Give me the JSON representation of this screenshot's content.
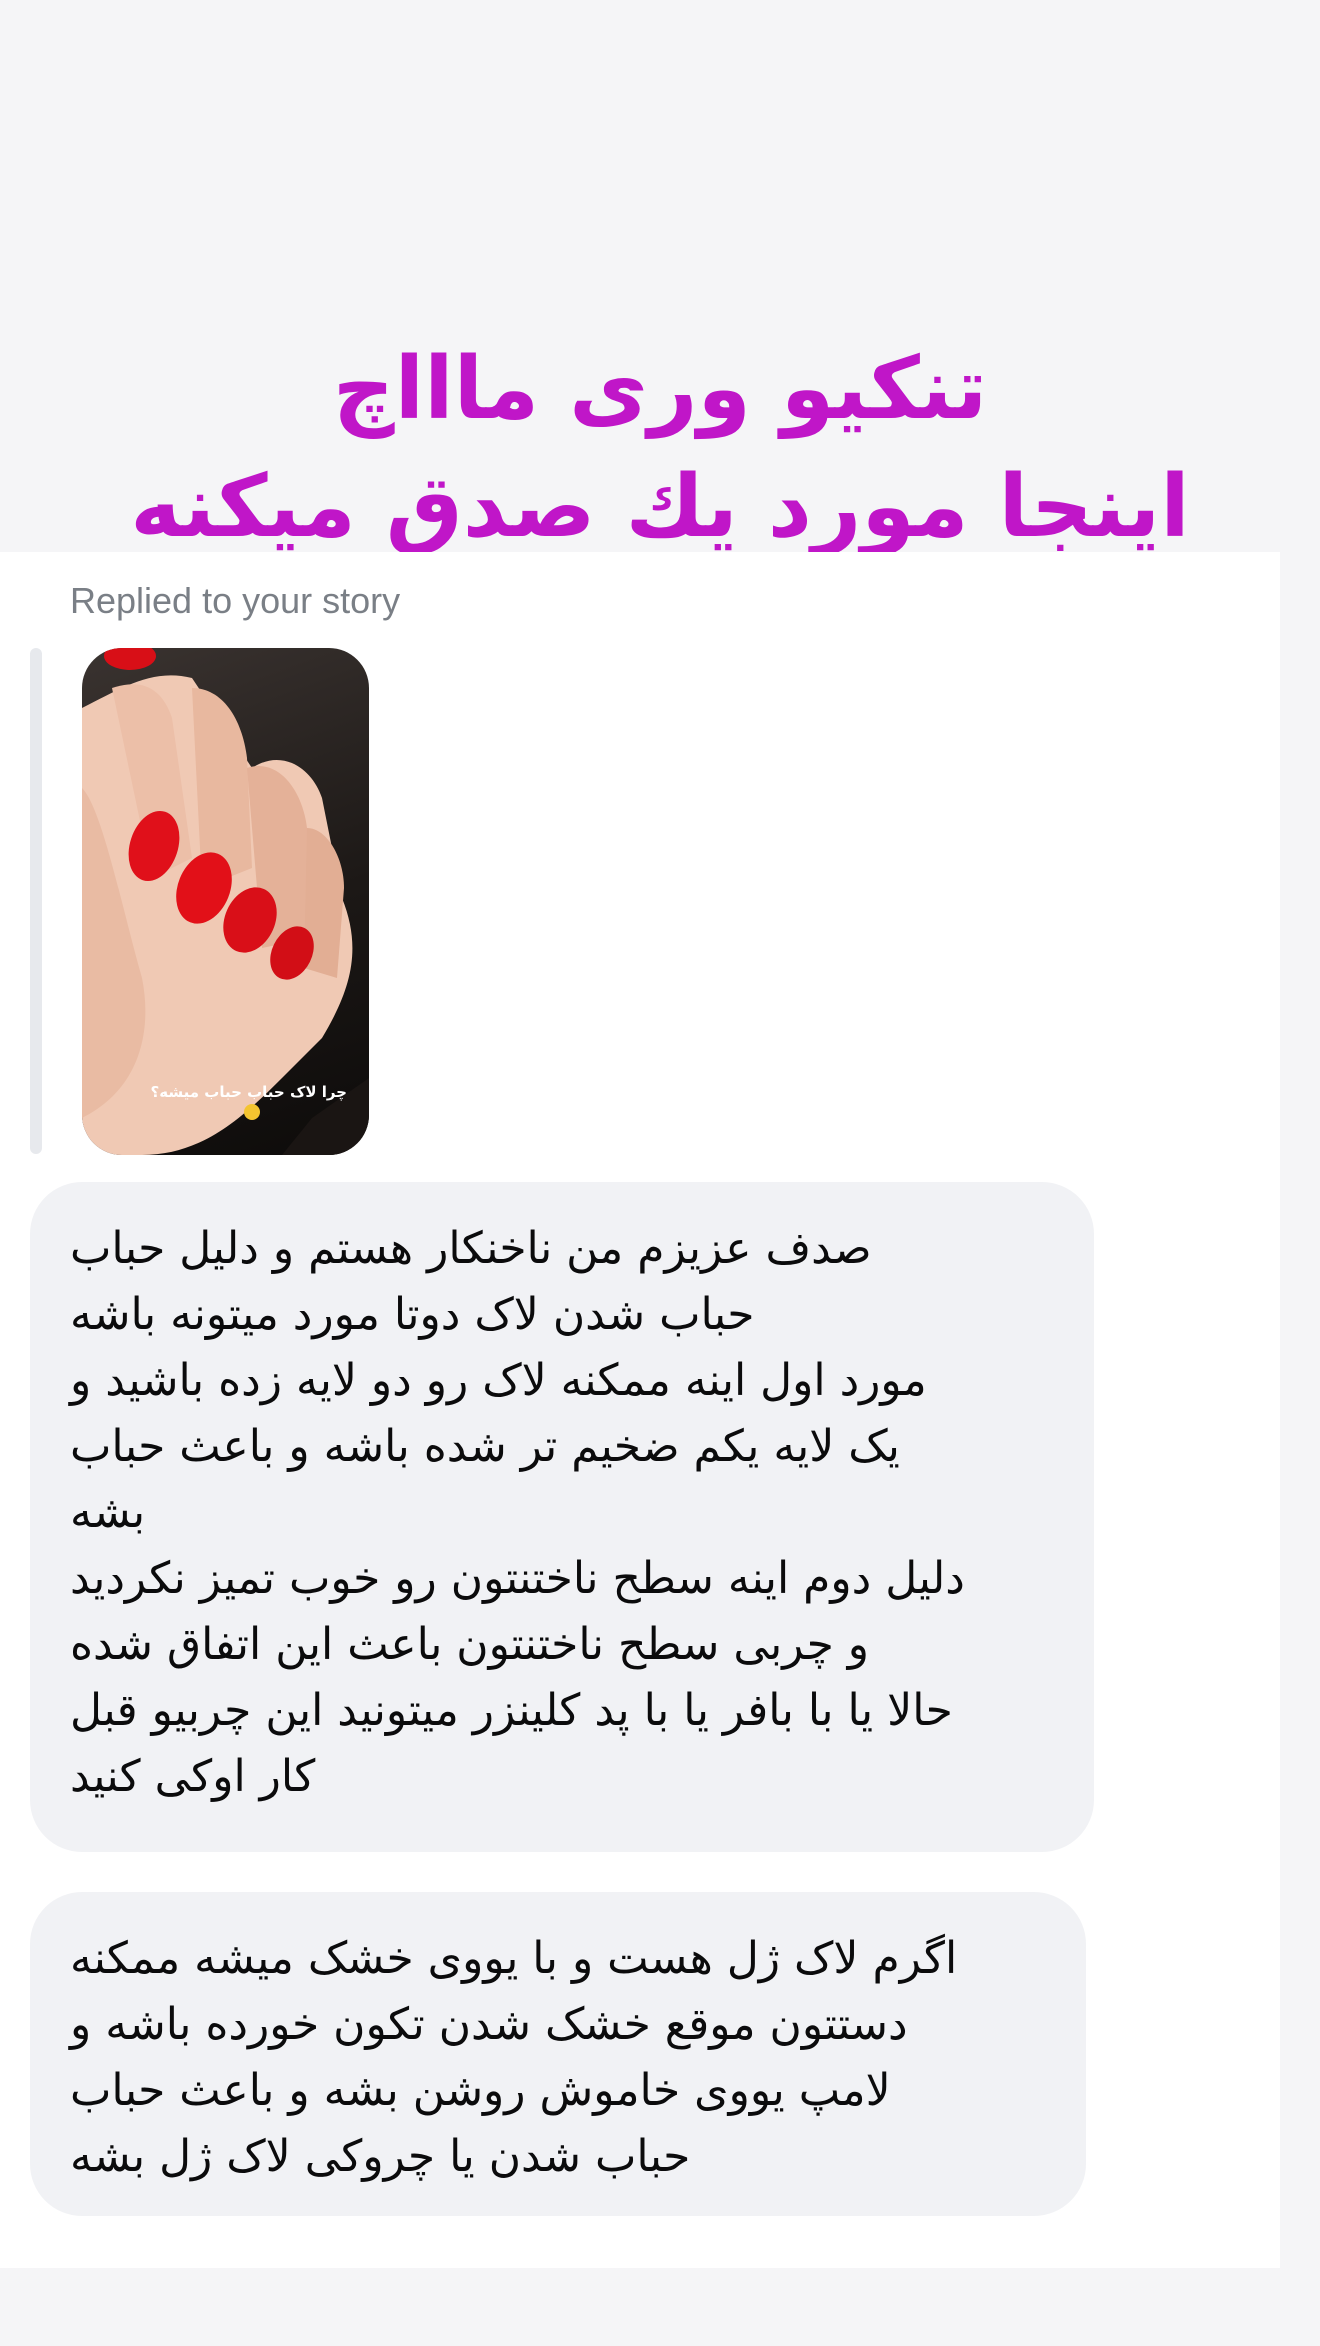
{
  "overlay_text": {
    "line1": "تنکیو وری ماااچ",
    "line2": "اینجا مورد یك صدق میکنه"
  },
  "reply": {
    "label": "Replied to your story",
    "story_caption": "چرا لاک حباب حباب میشه؟"
  },
  "messages": [
    {
      "lines": [
        "صدف عزیزم من ناخنکار هستم و دلیل حباب",
        "حباب شدن لاک دوتا مورد میتونه باشه",
        "مورد اول اینه ممکنه لاک رو دو لایه زده باشید و",
        "یک لایه یکم ضخیم تر شده باشه و باعث حباب",
        "بشه",
        "دلیل دوم اینه سطح ناختنتون رو خوب تمیز نکردید",
        "و چربی سطح ناختنتون باعث این اتفاق شده",
        "حالا یا با بافر یا با پد کلینزر میتونید این چربیو قبل",
        "کار اوکی کنید"
      ]
    },
    {
      "lines": [
        "اگرم لاک ژل هست و با یووی خشک میشه ممکنه",
        "دستتون موقع خشک شدن تکون خورده باشه و",
        "لامپ یووی خاموش روشن بشه و باعث حباب",
        "حباب شدن یا چروکی لاک ژل بشه"
      ]
    }
  ],
  "colors": {
    "headline": "#c016c8",
    "page_bg": "#f5f5f7",
    "bubble_bg": "#f1f2f5",
    "label": "#7a7f86"
  }
}
